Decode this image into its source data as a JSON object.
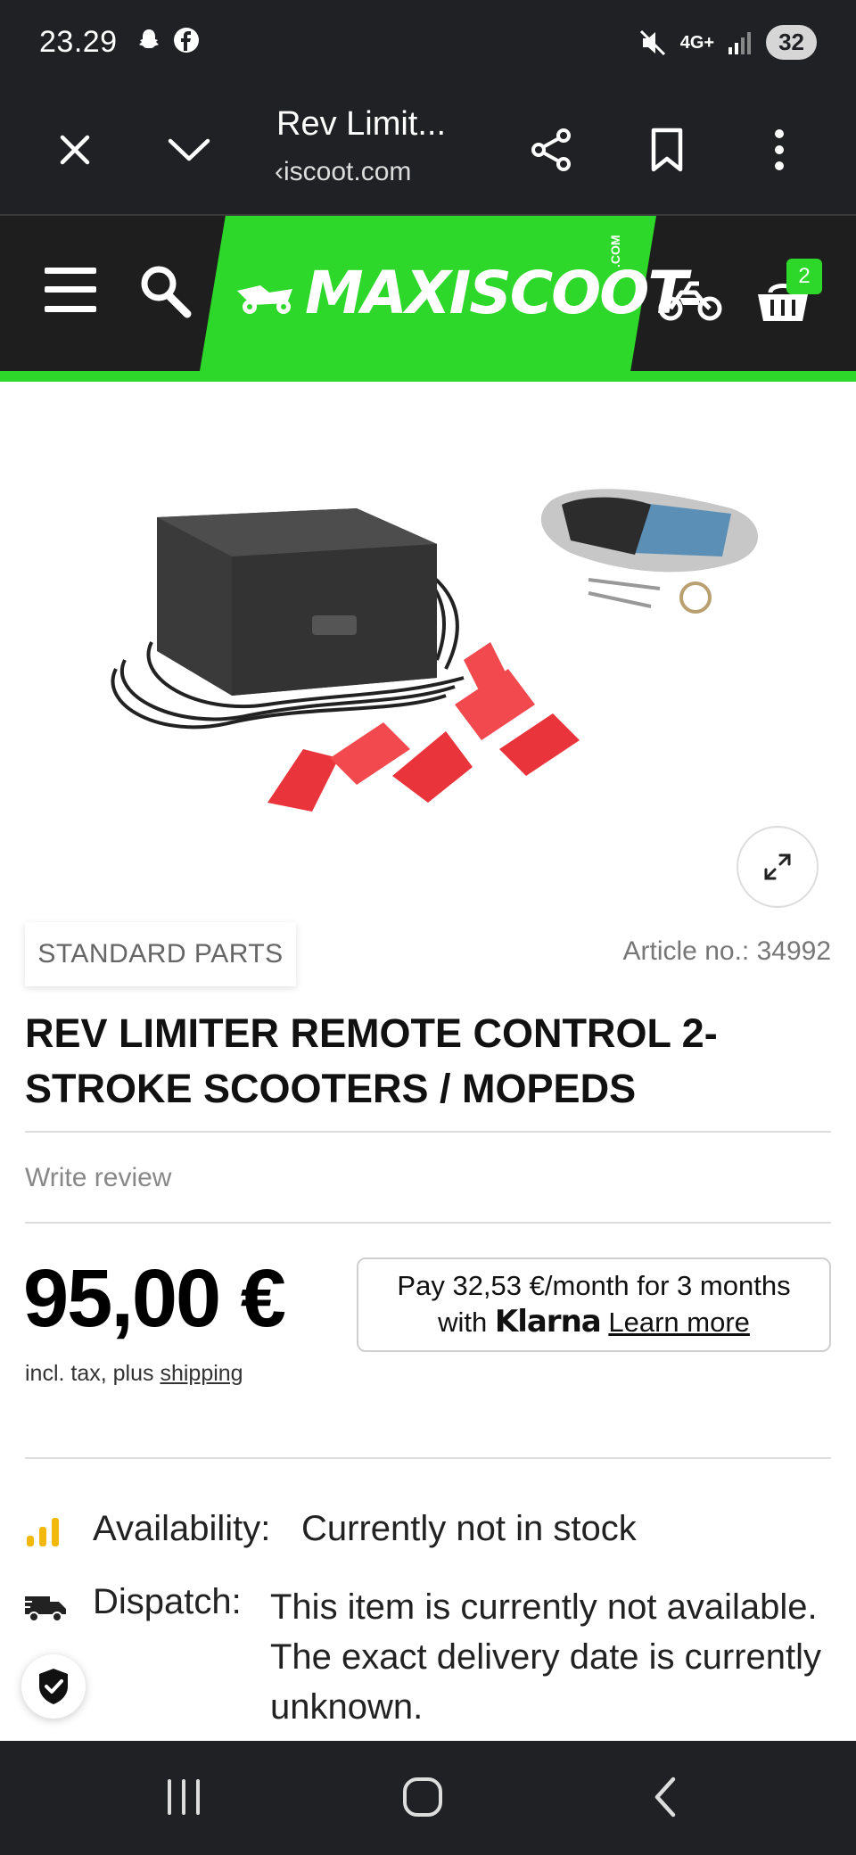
{
  "status_bar": {
    "time": "23.29",
    "network": "4G+",
    "battery": "32"
  },
  "browser": {
    "tab_title": "Rev Limit...",
    "url": "‹iscoot.com",
    "icons": [
      "close-icon",
      "chevron-down-icon",
      "share-icon",
      "bookmark-icon",
      "more-vert-icon"
    ]
  },
  "site": {
    "logo": "MAXISCOOT",
    "logo_suffix": ".COM",
    "cart_count": "2",
    "brand_color": "#2ed82a",
    "header_color": "#1e1e1e"
  },
  "product": {
    "category": "STANDARD PARTS",
    "article_no": "Article no.: 34992",
    "title": "REV LIMITER REMOTE CONTROL 2-STROKE SCOOTERS / MOPEDS",
    "write_review": "Write review",
    "price": "95,00 €",
    "tax_prefix": "incl. tax, plus ",
    "tax_link": "shipping"
  },
  "klarna": {
    "line1": "Pay 32,53 €/month for 3 months",
    "with": "with ",
    "brand": "Klarna",
    "link": "Learn more"
  },
  "stock": {
    "availability_label": "Availability:",
    "availability_value": "Currently not in stock",
    "dispatch_label": "Dispatch:",
    "dispatch_value": "This item is currently not available. The exact delivery date is currently unknown.",
    "availability_color": "#f2b90c"
  }
}
